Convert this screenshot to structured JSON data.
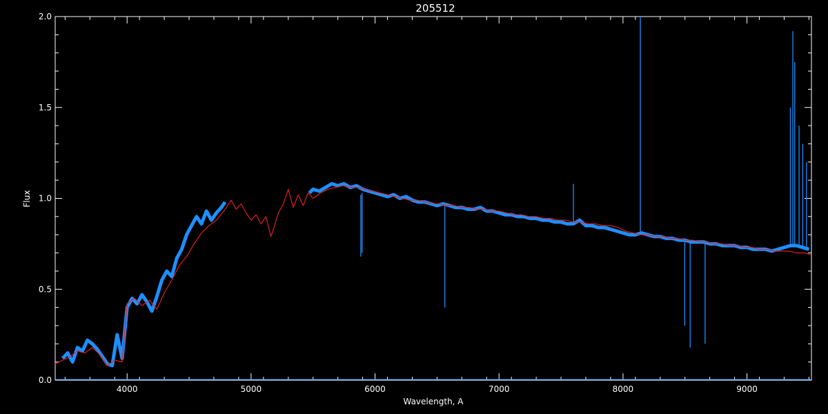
{
  "chart_data": {
    "type": "line",
    "title": "205512",
    "xlabel": "Wavelength, A",
    "ylabel": "Flux",
    "xlim": [
      3420,
      9520
    ],
    "ylim": [
      0,
      2
    ],
    "x_ticks": [
      "4000",
      "5000",
      "6000",
      "7000",
      "8000",
      "9000"
    ],
    "y_ticks": [
      "0.0",
      "0.5",
      "1.0",
      "1.5",
      "2.0"
    ],
    "grid": false,
    "colors": {
      "background": "#000000",
      "axes": "#ffffff",
      "observed": "#1e8fff",
      "model": "#e02020"
    },
    "series": [
      {
        "key": "observed",
        "color": "#1e8fff",
        "segments": [
          {
            "x": [
              3480,
              3520,
              3560,
              3600,
              3640,
              3680,
              3720,
              3760,
              3800,
              3840,
              3880,
              3920,
              3960,
              4000,
              4040,
              4080,
              4120,
              4160,
              4200,
              4240,
              4280,
              4320,
              4360,
              4400,
              4440,
              4480,
              4520,
              4560,
              4600,
              4640,
              4680,
              4720,
              4760,
              4790
            ],
            "y": [
              0.12,
              0.15,
              0.1,
              0.18,
              0.16,
              0.22,
              0.2,
              0.17,
              0.13,
              0.09,
              0.08,
              0.25,
              0.12,
              0.4,
              0.45,
              0.42,
              0.47,
              0.43,
              0.38,
              0.46,
              0.55,
              0.6,
              0.57,
              0.67,
              0.72,
              0.8,
              0.85,
              0.9,
              0.86,
              0.93,
              0.88,
              0.92,
              0.95,
              0.98
            ]
          },
          {
            "x": [
              5470,
              5500,
              5550,
              5600,
              5650,
              5700,
              5750,
              5800,
              5850,
              5900,
              5950,
              6000,
              6050,
              6100,
              6150,
              6200,
              6250,
              6300,
              6350,
              6400,
              6450,
              6500,
              6550,
              6600,
              6650,
              6700,
              6750,
              6800,
              6850,
              6900,
              6950,
              7000,
              7050,
              7100,
              7150,
              7200,
              7250,
              7300,
              7350,
              7400,
              7450,
              7500,
              7550,
              7600,
              7650,
              7700,
              7750,
              7800,
              7850,
              7900,
              7950,
              8000,
              8050,
              8100,
              8150,
              8200,
              8250,
              8300,
              8350,
              8400,
              8450,
              8500,
              8550,
              8600,
              8650,
              8700,
              8750,
              8800,
              8850,
              8900,
              8950,
              9000,
              9050,
              9100,
              9150,
              9200,
              9250,
              9300,
              9350,
              9400,
              9450,
              9500
            ],
            "y": [
              1.03,
              1.05,
              1.04,
              1.06,
              1.08,
              1.07,
              1.08,
              1.06,
              1.07,
              1.05,
              1.04,
              1.03,
              1.02,
              1.01,
              1.02,
              1.0,
              1.01,
              0.99,
              0.98,
              0.98,
              0.97,
              0.96,
              0.97,
              0.96,
              0.95,
              0.95,
              0.94,
              0.94,
              0.95,
              0.93,
              0.93,
              0.92,
              0.91,
              0.91,
              0.9,
              0.9,
              0.89,
              0.89,
              0.88,
              0.88,
              0.87,
              0.87,
              0.86,
              0.86,
              0.88,
              0.85,
              0.85,
              0.84,
              0.84,
              0.83,
              0.82,
              0.81,
              0.8,
              0.8,
              0.81,
              0.8,
              0.79,
              0.79,
              0.78,
              0.78,
              0.77,
              0.77,
              0.76,
              0.76,
              0.76,
              0.75,
              0.75,
              0.74,
              0.74,
              0.74,
              0.73,
              0.73,
              0.72,
              0.72,
              0.72,
              0.71,
              0.72,
              0.73,
              0.74,
              0.74,
              0.73,
              0.72
            ]
          }
        ]
      },
      {
        "key": "model",
        "color": "#e02020",
        "segments": [
          {
            "x": [
              3420,
              3480,
              3540,
              3600,
              3660,
              3720,
              3780,
              3840,
              3900,
              3960,
              4000,
              4060,
              4120,
              4180,
              4240,
              4300,
              4360,
              4420,
              4480,
              4540,
              4600,
              4660,
              4720,
              4780,
              4840,
              4880,
              4920,
              4960,
              5000,
              5040,
              5080,
              5120,
              5160,
              5180,
              5220,
              5260,
              5300,
              5340,
              5380,
              5420,
              5460,
              5500,
              5560,
              5620,
              5680,
              5740,
              5800,
              5860,
              5920,
              5980,
              6040,
              6100,
              6160,
              6220,
              6280,
              6340,
              6400,
              6460,
              6520,
              6580,
              6640,
              6700,
              6760,
              6820,
              6880,
              6940,
              7000,
              7060,
              7120,
              7180,
              7240,
              7300,
              7360,
              7420,
              7480,
              7540,
              7600,
              7660,
              7720,
              7780,
              7840,
              7900,
              7960,
              8020,
              8080,
              8140,
              8200,
              8260,
              8320,
              8380,
              8440,
              8500,
              8560,
              8620,
              8680,
              8740,
              8800,
              8860,
              8920,
              8980,
              9040,
              9100,
              9160,
              9220,
              9280,
              9340,
              9400,
              9460,
              9520
            ],
            "y": [
              0.09,
              0.11,
              0.13,
              0.16,
              0.15,
              0.18,
              0.14,
              0.08,
              0.11,
              0.1,
              0.42,
              0.45,
              0.41,
              0.44,
              0.39,
              0.48,
              0.55,
              0.63,
              0.68,
              0.75,
              0.81,
              0.85,
              0.88,
              0.93,
              0.99,
              0.94,
              0.97,
              0.92,
              0.88,
              0.91,
              0.86,
              0.9,
              0.79,
              0.83,
              0.92,
              0.97,
              1.05,
              0.95,
              1.02,
              0.96,
              1.03,
              1.0,
              1.03,
              1.05,
              1.06,
              1.07,
              1.06,
              1.06,
              1.05,
              1.04,
              1.03,
              1.02,
              1.01,
              1.0,
              0.99,
              0.99,
              0.98,
              0.97,
              0.97,
              0.96,
              0.96,
              0.95,
              0.95,
              0.94,
              0.94,
              0.93,
              0.93,
              0.92,
              0.91,
              0.91,
              0.9,
              0.9,
              0.89,
              0.89,
              0.88,
              0.88,
              0.87,
              0.87,
              0.86,
              0.86,
              0.85,
              0.85,
              0.84,
              0.82,
              0.81,
              0.8,
              0.8,
              0.79,
              0.79,
              0.78,
              0.78,
              0.77,
              0.77,
              0.76,
              0.76,
              0.75,
              0.75,
              0.74,
              0.74,
              0.73,
              0.73,
              0.72,
              0.72,
              0.71,
              0.71,
              0.71,
              0.7,
              0.7,
              0.69
            ]
          }
        ]
      }
    ],
    "spikes": [
      {
        "x": 5885,
        "y0": 1.02,
        "y1": 0.68
      },
      {
        "x": 5895,
        "y0": 1.03,
        "y1": 0.7
      },
      {
        "x": 6563,
        "y0": 0.97,
        "y1": 0.4
      },
      {
        "x": 7600,
        "y0": 0.87,
        "y1": 1.08
      },
      {
        "x": 8140,
        "y0": 0.8,
        "y1": 2.0
      },
      {
        "x": 8498,
        "y0": 0.78,
        "y1": 0.3
      },
      {
        "x": 8542,
        "y0": 0.77,
        "y1": 0.18
      },
      {
        "x": 8662,
        "y0": 0.76,
        "y1": 0.2
      },
      {
        "x": 9350,
        "y0": 0.74,
        "y1": 1.5
      },
      {
        "x": 9370,
        "y0": 0.74,
        "y1": 1.92
      },
      {
        "x": 9385,
        "y0": 0.74,
        "y1": 1.75
      },
      {
        "x": 9420,
        "y0": 0.74,
        "y1": 1.4
      },
      {
        "x": 9450,
        "y0": 0.73,
        "y1": 1.3
      },
      {
        "x": 9480,
        "y0": 0.73,
        "y1": 1.2
      }
    ]
  }
}
